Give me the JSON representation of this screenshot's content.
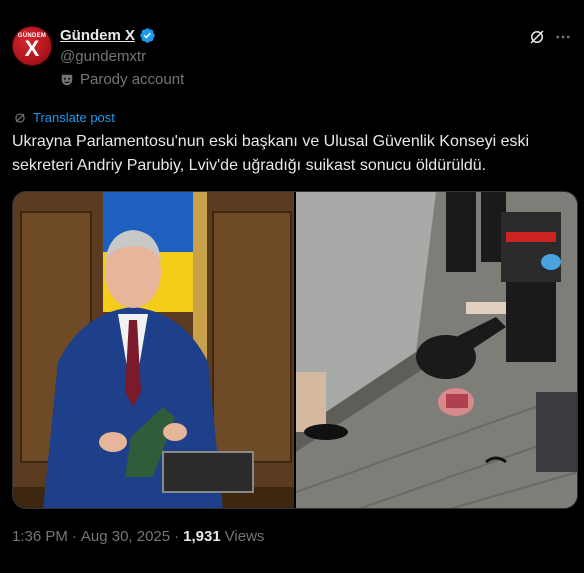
{
  "author": {
    "avatar_top_text": "GÜNDEM",
    "avatar_letter": "X",
    "name": "Gündem X",
    "handle": "@gundemxtr",
    "parody_label": "Parody account"
  },
  "translate_label": "Translate post",
  "tweet_text": "Ukrayna Parlamentosu'nun eski başkanı ve Ulusal Güvenlik Konseyi eski sekreteri Andriy Parubiy, Lviv'de uğradığı suikast sonucu öldürüldü.",
  "footer": {
    "time": "1:36 PM",
    "sep1": "·",
    "date": "Aug 30, 2025",
    "sep2": "·",
    "views_count": "1,931",
    "views_label": "Views"
  },
  "icons": {
    "verified": "verified-badge-icon",
    "parody": "parody-mask-icon",
    "grok": "grok-icon",
    "more": "more-options-icon",
    "translate": "translate-icon"
  },
  "colors": {
    "background": "#000000",
    "text": "#e7e9ea",
    "secondary": "#71767b",
    "accent": "#1d9bf0"
  }
}
